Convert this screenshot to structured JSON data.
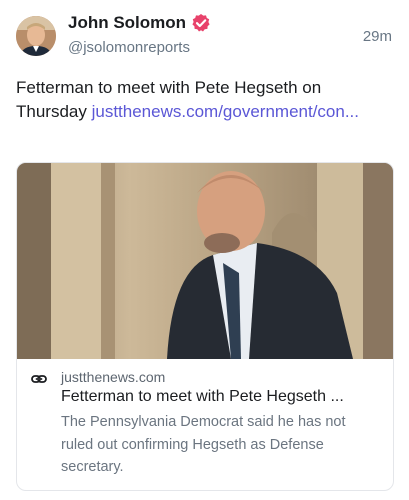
{
  "author": {
    "name": "John Solomon",
    "handle": "@jsolomonreports",
    "avatar_icon": "avatar-photo",
    "verified_icon": "verified-badge-icon",
    "verified_color": "#e8426b"
  },
  "post": {
    "timestamp": "29m",
    "text": "Fetterman to meet with Pete Hegseth on Thursday ",
    "link_text": "justthenews.com/government/con..."
  },
  "link_card": {
    "image_icon": "news-photo",
    "link_icon": "link-icon",
    "domain": "justthenews.com",
    "title": "Fetterman to meet with Pete Hegseth ...",
    "description": "The Pennsylvania Democrat said he has not ruled out confirming Hegseth as Defense secretary."
  },
  "colors": {
    "link": "#5b57d6",
    "muted": "#687684",
    "border": "#e4e6ea"
  }
}
